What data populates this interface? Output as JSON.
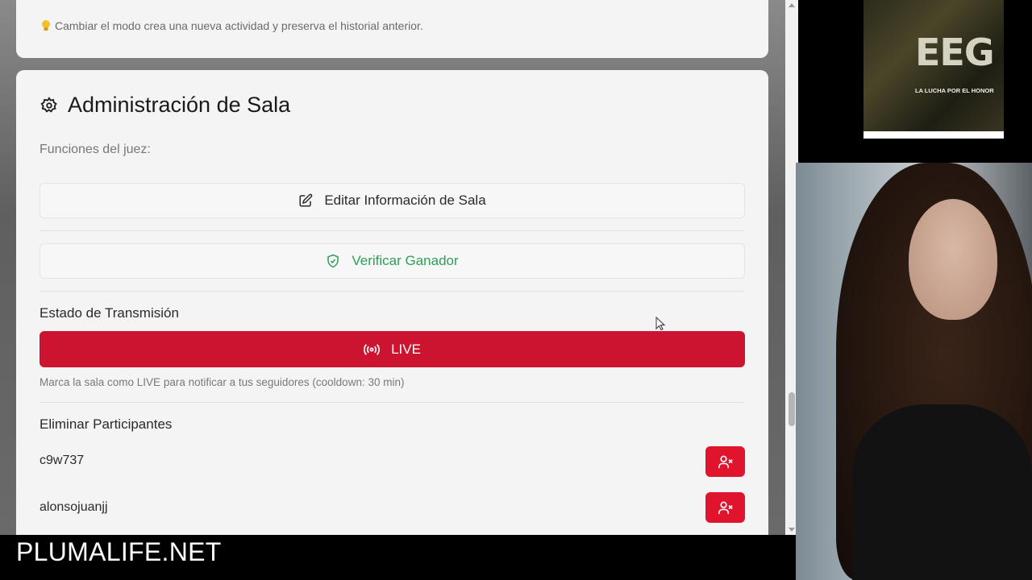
{
  "top_card": {
    "hint": "Cambiar el modo crea una nueva actividad y preserva el historial anterior."
  },
  "admin": {
    "title": "Administración de Sala",
    "subtitle": "Funciones del juez:",
    "edit_button": "Editar Información de Sala",
    "verify_button": "Verificar Ganador",
    "verify_color": "#2e9e57"
  },
  "transmission": {
    "label": "Estado de Transmisión",
    "live_button": "LIVE",
    "live_color": "#cc1430",
    "note": "Marca la sala como LIVE para notificar a tus seguidores (cooldown: 30 min)"
  },
  "participants": {
    "label": "Eliminar Participantes",
    "items": [
      {
        "name": "c9w737"
      },
      {
        "name": "alonsojuanjj"
      }
    ],
    "remove_color": "#e0142d"
  },
  "thumbnail": {
    "title": "EEG",
    "subtitle": "LA LUCHA POR EL HONOR"
  },
  "footer": {
    "watermark": "PLUMALIFE.NET"
  }
}
